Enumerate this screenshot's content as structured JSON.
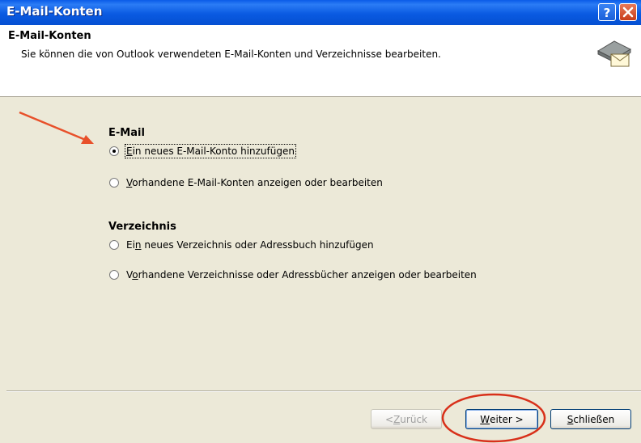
{
  "window": {
    "title": "E-Mail-Konten",
    "help_icon": "question-mark-icon",
    "close_icon": "close-x-icon"
  },
  "header": {
    "title": "E-Mail-Konten",
    "subtitle": "Sie können die von Outlook verwendeten E-Mail-Konten und Verzeichnisse bearbeiten.",
    "icon": "mail-accounts-icon"
  },
  "email_section": {
    "heading": "E-Mail",
    "options": [
      {
        "mnemonic": "E",
        "rest": "in neues E-Mail-Konto hinzufügen",
        "checked": true
      },
      {
        "mnemonic": "V",
        "rest": "orhandene E-Mail-Konten anzeigen oder bearbeiten",
        "checked": false
      }
    ]
  },
  "directory_section": {
    "heading": "Verzeichnis",
    "options": [
      {
        "prefix": "Ei",
        "mnemonic": "n",
        "rest": " neues Verzeichnis oder Adressbuch hinzufügen",
        "checked": false
      },
      {
        "prefix": "V",
        "mnemonic": "o",
        "rest": "rhandene Verzeichnisse oder Adressbücher anzeigen oder bearbeiten",
        "checked": false
      }
    ]
  },
  "buttons": {
    "back": {
      "prefix": "< ",
      "mnemonic": "Z",
      "rest": "urück",
      "enabled": false
    },
    "next": {
      "mnemonic": "W",
      "rest": "eiter >",
      "enabled": true
    },
    "close": {
      "mnemonic": "S",
      "rest": "chließen",
      "enabled": true
    }
  },
  "annotations": {
    "arrow_color": "#e8502a",
    "circle_color": "#d8301a"
  }
}
